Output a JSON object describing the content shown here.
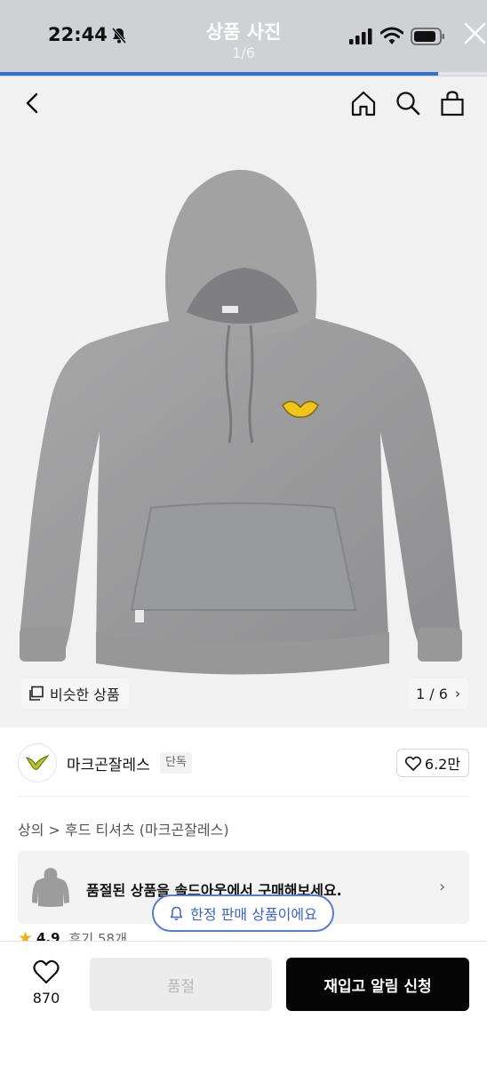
{
  "status_bar": {
    "time": "22:44",
    "viewer_title": "상품 사진",
    "viewer_count": "1/6",
    "progress": 0.9
  },
  "nav": {
    "back_icon": "chevron-left-icon",
    "home_icon": "home-icon",
    "search_icon": "search-icon",
    "cart_icon": "shopping-bag-icon"
  },
  "product_image": {
    "similar_label": "비슷한 상품",
    "page_indicator": "1 / 6",
    "chevron": "›"
  },
  "brand": {
    "name": "마크곤잘레스",
    "badge": "단독",
    "likes": "6.2만"
  },
  "breadcrumb": "상의 > 후드 티셔츠 (마크곤잘레스)",
  "banner": {
    "text": "품절된 상품을 솔드아웃에서 구매해보세요.",
    "chevron": "›"
  },
  "limited_notice": "한정 판매 상품이에요",
  "rating": {
    "score": "4.9",
    "reviews": "후기 58개"
  },
  "bottom_bar": {
    "wish_count": "870",
    "soldout_label": "품절",
    "restock_label": "재입고 알림 신청"
  },
  "colors": {
    "accent_blue": "#2f6fd6",
    "pill_blue": "#3f63c7",
    "star": "#f2b21a",
    "black_button": "#050505"
  }
}
